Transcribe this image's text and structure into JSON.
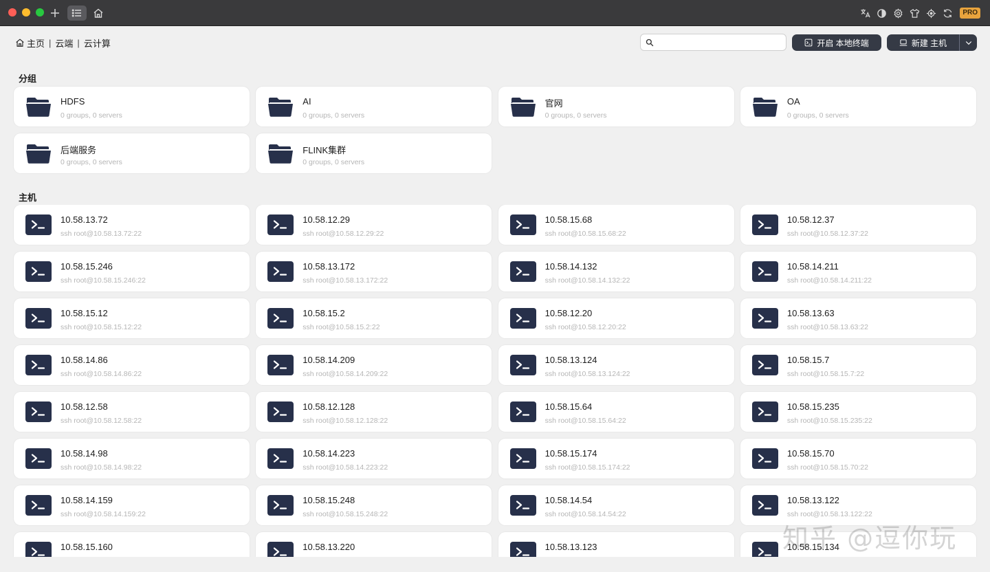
{
  "toolbar": {
    "left_icons": [
      "plus-icon",
      "list-icon",
      "home-icon"
    ],
    "right_icons": [
      "translate-icon",
      "contrast-icon",
      "gear-icon",
      "shirt-icon",
      "target-icon",
      "sync-icon"
    ],
    "pro_badge": "PRO",
    "colors": {
      "bar": "#3a3a3c",
      "pro": "#e8a33d"
    }
  },
  "breadcrumb": {
    "items": [
      "主页",
      "云端",
      "云计算"
    ],
    "separator": "|"
  },
  "search": {
    "value": "",
    "placeholder": ""
  },
  "actions": {
    "terminal_label": "开启 本地终端",
    "new_host_label": "新建 主机"
  },
  "groups": {
    "title": "分组",
    "items": [
      {
        "name": "HDFS",
        "meta": "0 groups, 0 servers"
      },
      {
        "name": "AI",
        "meta": "0 groups, 0 servers"
      },
      {
        "name": "官网",
        "meta": "0 groups, 0 servers"
      },
      {
        "name": "OA",
        "meta": "0 groups, 0 servers"
      },
      {
        "name": "后端服务",
        "meta": "0 groups, 0 servers"
      },
      {
        "name": "FLINK集群",
        "meta": "0 groups, 0 servers"
      }
    ]
  },
  "hosts": {
    "title": "主机",
    "items": [
      {
        "name": "10.58.13.72",
        "cmd": "ssh root@10.58.13.72:22"
      },
      {
        "name": "10.58.12.29",
        "cmd": "ssh root@10.58.12.29:22"
      },
      {
        "name": "10.58.15.68",
        "cmd": "ssh root@10.58.15.68:22"
      },
      {
        "name": "10.58.12.37",
        "cmd": "ssh root@10.58.12.37:22"
      },
      {
        "name": "10.58.15.246",
        "cmd": "ssh root@10.58.15.246:22"
      },
      {
        "name": "10.58.13.172",
        "cmd": "ssh root@10.58.13.172:22"
      },
      {
        "name": "10.58.14.132",
        "cmd": "ssh root@10.58.14.132:22"
      },
      {
        "name": "10.58.14.211",
        "cmd": "ssh root@10.58.14.211:22"
      },
      {
        "name": "10.58.15.12",
        "cmd": "ssh root@10.58.15.12:22"
      },
      {
        "name": "10.58.15.2",
        "cmd": "ssh root@10.58.15.2:22"
      },
      {
        "name": "10.58.12.20",
        "cmd": "ssh root@10.58.12.20:22"
      },
      {
        "name": "10.58.13.63",
        "cmd": "ssh root@10.58.13.63:22"
      },
      {
        "name": "10.58.14.86",
        "cmd": "ssh root@10.58.14.86:22"
      },
      {
        "name": "10.58.14.209",
        "cmd": "ssh root@10.58.14.209:22"
      },
      {
        "name": "10.58.13.124",
        "cmd": "ssh root@10.58.13.124:22"
      },
      {
        "name": "10.58.15.7",
        "cmd": "ssh root@10.58.15.7:22"
      },
      {
        "name": "10.58.12.58",
        "cmd": "ssh root@10.58.12.58:22"
      },
      {
        "name": "10.58.12.128",
        "cmd": "ssh root@10.58.12.128:22"
      },
      {
        "name": "10.58.15.64",
        "cmd": "ssh root@10.58.15.64:22"
      },
      {
        "name": "10.58.15.235",
        "cmd": "ssh root@10.58.15.235:22"
      },
      {
        "name": "10.58.14.98",
        "cmd": "ssh root@10.58.14.98:22"
      },
      {
        "name": "10.58.14.223",
        "cmd": "ssh root@10.58.14.223:22"
      },
      {
        "name": "10.58.15.174",
        "cmd": "ssh root@10.58.15.174:22"
      },
      {
        "name": "10.58.15.70",
        "cmd": "ssh root@10.58.15.70:22"
      },
      {
        "name": "10.58.14.159",
        "cmd": "ssh root@10.58.14.159:22"
      },
      {
        "name": "10.58.15.248",
        "cmd": "ssh root@10.58.15.248:22"
      },
      {
        "name": "10.58.14.54",
        "cmd": "ssh root@10.58.14.54:22"
      },
      {
        "name": "10.58.13.122",
        "cmd": "ssh root@10.58.13.122:22"
      },
      {
        "name": "10.58.15.160",
        "cmd": ""
      },
      {
        "name": "10.58.13.220",
        "cmd": ""
      },
      {
        "name": "10.58.13.123",
        "cmd": ""
      },
      {
        "name": "10.58.15.134",
        "cmd": ""
      }
    ]
  },
  "watermark": "知乎 @逗你玩",
  "colors": {
    "icon_fill": "#27304a",
    "button_dark": "#353a45",
    "card": "#ffffff",
    "background": "#f0f0f0"
  }
}
